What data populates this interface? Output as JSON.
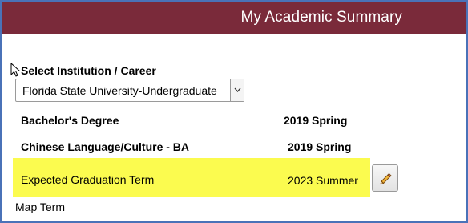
{
  "header": {
    "title": "My Academic Summary"
  },
  "institution": {
    "label": "Select Institution / Career",
    "selected": "Florida State University-Undergraduate"
  },
  "rows": [
    {
      "label": "Bachelor's Degree",
      "term": "2019 Spring"
    },
    {
      "label": "Chinese Language/Culture - BA",
      "term": "2019 Spring"
    },
    {
      "label": "Expected Graduation Term",
      "term": "2023 Summer"
    }
  ],
  "map_term": "Map Term",
  "colors": {
    "header_bg": "#7a2a3a",
    "highlight": "#fbfb4f",
    "frame_border": "#4a72b8"
  },
  "icons": {
    "edit": "pencil-icon",
    "dropdown": "chevron-down-icon",
    "cursor": "mouse-pointer-icon"
  }
}
